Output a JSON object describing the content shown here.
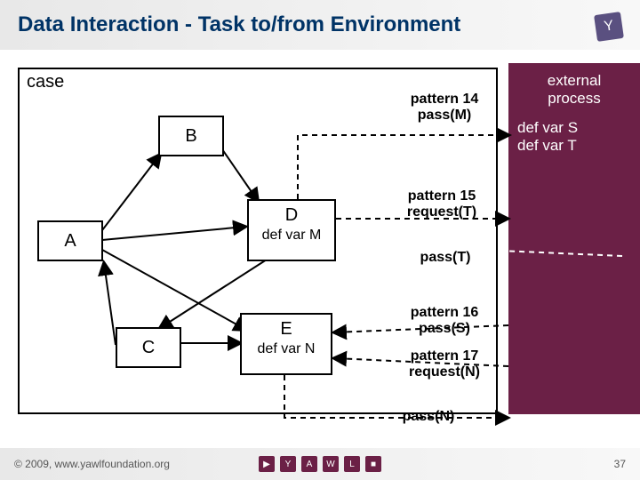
{
  "header": {
    "title": "Data Interaction - Task to/from Environment"
  },
  "case_label": "case",
  "nodes": {
    "a": "A",
    "b": "B",
    "c": "C",
    "d": {
      "label": "D",
      "sub": "def var M"
    },
    "e": {
      "label": "E",
      "sub": "def var N"
    }
  },
  "external": {
    "title_l1": "external",
    "title_l2": "process",
    "def1": "def var S",
    "def2": "def var T"
  },
  "annotations": {
    "p14_l1": "pattern 14",
    "p14_l2": "pass(M)",
    "p15_l1": "pattern 15",
    "p15_l2": "request(T)",
    "passT": "pass(T)",
    "p16_l1": "pattern 16",
    "p16_l2": "pass(S)",
    "p17_l1": "pattern 17",
    "p17_l2": "request(N)",
    "passN": "pass(N)"
  },
  "footer": {
    "copyright": "© 2009, www.yawlfoundation.org",
    "page": "37"
  }
}
